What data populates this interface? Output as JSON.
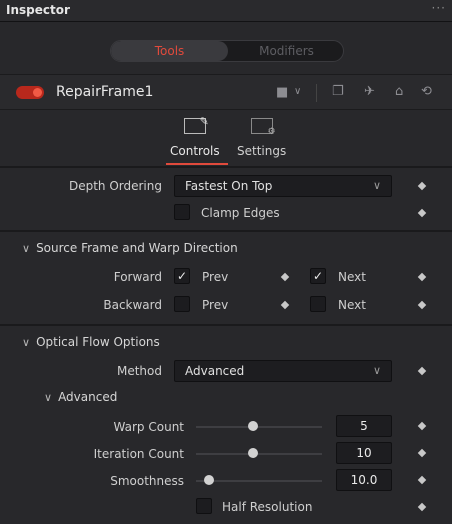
{
  "titlebar": {
    "title": "Inspector",
    "menu_icon": "more-icon"
  },
  "mode_tabs": [
    {
      "label": "Tools",
      "active": true
    },
    {
      "label": "Modifiers",
      "active": false
    }
  ],
  "node": {
    "name": "RepairFrame1",
    "enabled": true,
    "color": "#b8281c"
  },
  "tabs": [
    {
      "label": "Controls",
      "active": true
    },
    {
      "label": "Settings",
      "active": false
    }
  ],
  "depth_ordering": {
    "label": "Depth Ordering",
    "value": "Fastest On Top"
  },
  "clamp_edges": {
    "label": "Clamp Edges",
    "checked": false
  },
  "source_frame": {
    "title": "Source Frame and Warp Direction",
    "forward": {
      "label": "Forward",
      "prev_label": "Prev",
      "prev_checked": true,
      "next_label": "Next",
      "next_checked": true
    },
    "backward": {
      "label": "Backward",
      "prev_label": "Prev",
      "prev_checked": false,
      "next_label": "Next",
      "next_checked": false
    }
  },
  "optical_flow": {
    "title": "Optical Flow Options",
    "method": {
      "label": "Method",
      "value": "Advanced"
    },
    "advanced": {
      "title": "Advanced",
      "warp_count": {
        "label": "Warp Count",
        "value": "5",
        "level": 0.45
      },
      "iteration_count": {
        "label": "Iteration Count",
        "value": "10",
        "level": 0.45
      },
      "smoothness": {
        "label": "Smoothness",
        "value": "10.0",
        "level": 0.1
      },
      "half_resolution": {
        "label": "Half Resolution",
        "checked": false
      }
    }
  },
  "checkmark": "✓"
}
